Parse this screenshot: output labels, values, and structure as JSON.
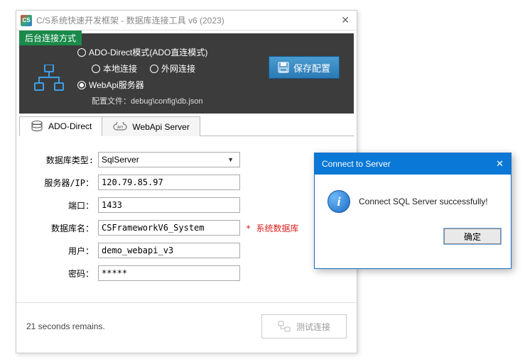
{
  "window": {
    "title": "C/S系统快速开发框架 - 数据库连接工具 v6 (2023)"
  },
  "panel": {
    "tag": "后台连接方式",
    "mode_ado": "ADO-Direct模式(ADO直连模式)",
    "mode_local": "本地连接",
    "mode_external": "外网连接",
    "mode_webapi": "WebApi服务器",
    "config_label": "配置文件：",
    "config_path": "debug\\config\\db.json",
    "save_btn": "保存配置"
  },
  "tabs": {
    "ado": "ADO-Direct",
    "webapi": "WebApi Server"
  },
  "form": {
    "db_type_label": "数据库类型:",
    "db_type_value": "SqlServer",
    "server_label": "服务器/IP：",
    "server_value": "120.79.85.97",
    "port_label": "端口：",
    "port_value": "1433",
    "dbname_label": "数据库名：",
    "dbname_value": "CSFrameworkV6_System",
    "dbname_note": "* 系统数据库",
    "user_label": "用户：",
    "user_value": "demo_webapi_v3",
    "pwd_label": "密码：",
    "pwd_value": "*****"
  },
  "footer": {
    "status": "21 seconds remains.",
    "test_btn": "测试连接"
  },
  "dialog": {
    "title": "Connect to Server",
    "message": "Connect SQL Server successfully!",
    "ok": "确定"
  }
}
